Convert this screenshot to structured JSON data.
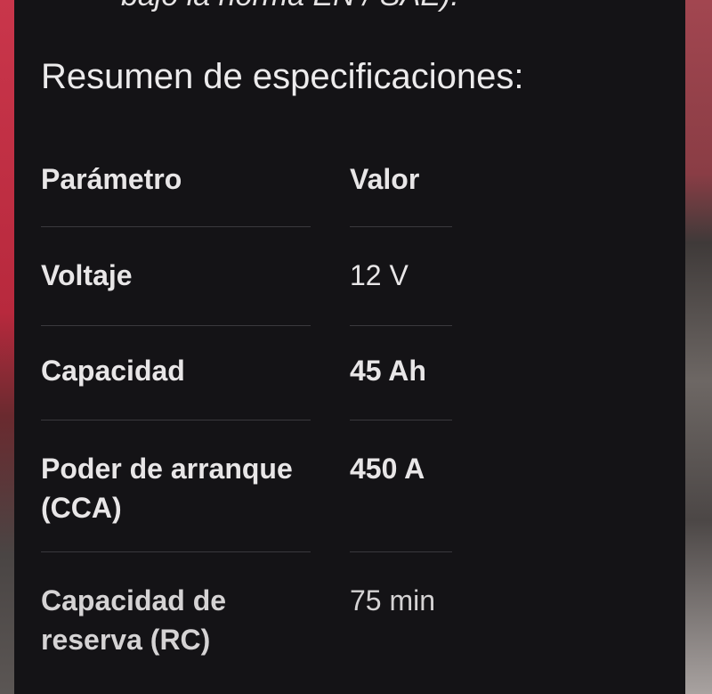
{
  "top_fragment": "bajo la norma EN / SAE).",
  "summary": {
    "title": "Resumen de especificaciones:"
  },
  "table": {
    "headers": {
      "param": "Parámetro",
      "value": "Valor"
    },
    "rows": [
      {
        "param": "Voltaje",
        "value": "12 V"
      },
      {
        "param": "Capacidad",
        "value": "45 Ah"
      },
      {
        "param": "Poder de arranque (CCA)",
        "value": "450 A"
      },
      {
        "param": "Capacidad de reserva (RC)",
        "value": "75 min"
      }
    ]
  },
  "colors": {
    "panel_background": "#141316",
    "text": "#e8e6e7",
    "divider": "#3a393d"
  }
}
